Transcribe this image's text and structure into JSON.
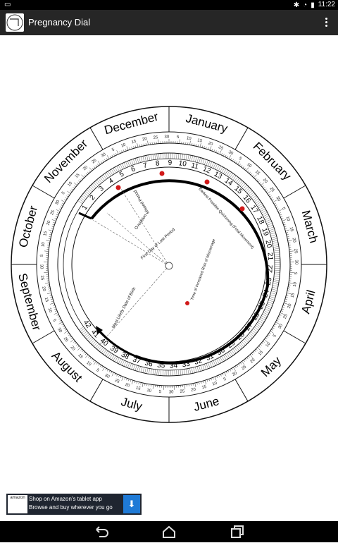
{
  "status": {
    "time": "11:22"
  },
  "app": {
    "title": "Pregnancy Dial"
  },
  "dial": {
    "months": [
      "January",
      "February",
      "March",
      "April",
      "May",
      "June",
      "July",
      "August",
      "September",
      "October",
      "November",
      "December"
    ],
    "weeks": [
      "1",
      "2",
      "3",
      "4",
      "5",
      "6",
      "7",
      "8",
      "9",
      "10",
      "11",
      "12",
      "13",
      "14",
      "15",
      "16",
      "17",
      "18",
      "19",
      "20",
      "21",
      "22",
      "23",
      "24",
      "25",
      "26",
      "27",
      "28",
      "29",
      "30",
      "31",
      "32",
      "33",
      "34",
      "35",
      "36",
      "37",
      "38",
      "39",
      "40",
      "41",
      "42"
    ],
    "day_ticks": [
      "5",
      "10",
      "15",
      "20",
      "25",
      "30"
    ],
    "labels": {
      "first_day": "First Day of Last Period",
      "ovulation": "Ovulation",
      "missed_period": "Missed Period",
      "quickening": "Earliest Possible Quickening (Fetal Movement)",
      "miscarriage": "Time of Increased Risk of Miscarriage",
      "birth": "Most Likely Date of Birth"
    }
  },
  "ad": {
    "brand": "amazon",
    "line1": "Shop on Amazon's tablet app",
    "line2": "Browse and buy wherever you go"
  },
  "colors": {
    "accent_red": "#d11a1a",
    "actionbar": "#262626"
  }
}
